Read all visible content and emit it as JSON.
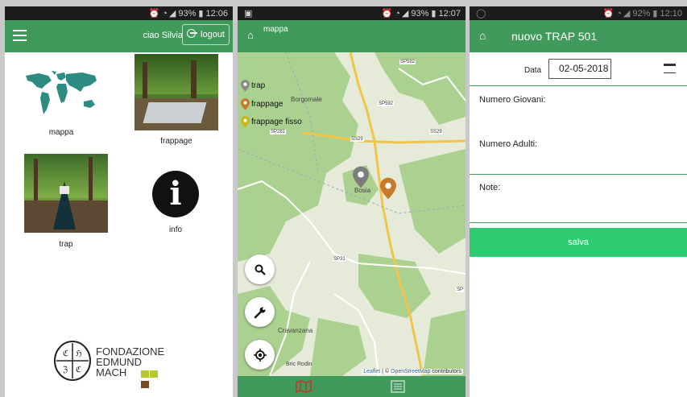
{
  "screen1": {
    "status_time": "12:06",
    "status_battery": "93%",
    "greeting": "ciao Silvia",
    "logout_label": "logout",
    "tiles": [
      {
        "label": "mappa"
      },
      {
        "label": "frappage"
      },
      {
        "label": "trap"
      },
      {
        "label": "info"
      }
    ],
    "logo": {
      "line1": "FONDAZIONE",
      "line2": "EDMUND",
      "line3": "MACH"
    }
  },
  "screen2": {
    "status_time": "12:07",
    "status_battery": "93%",
    "title": "mappa",
    "legend": [
      {
        "label": "trap",
        "color": "#8a8a8a"
      },
      {
        "label": "frappage",
        "color": "#c77a2c"
      },
      {
        "label": "frappage fisso",
        "color": "#c9b51c"
      }
    ],
    "place_labels": [
      "Borgomale",
      "Bosia",
      "Cravanzana",
      "Bric Rodin"
    ],
    "road_labels": [
      "SP592",
      "SP592",
      "SP281",
      "SS29",
      "SS29",
      "SP31",
      "SP"
    ],
    "attribution": {
      "leaflet": "Leaflet",
      "sep": " | © ",
      "osm": "OpenStreetMap",
      "rest": " contributors"
    },
    "markers": [
      {
        "type": "trap",
        "color": "#7d7d7d"
      },
      {
        "type": "frappage",
        "color": "#c77a2c"
      }
    ]
  },
  "screen3": {
    "status_time": "12:10",
    "status_battery": "92%",
    "title": "nuovo TRAP 501",
    "date_label": "Data",
    "date_value": "02-05-2018",
    "fields": [
      "Numero Giovani:",
      "Numero Adulti:",
      "Note:"
    ],
    "save_label": "salva"
  },
  "colors": {
    "primary": "#3f9a5b",
    "save": "#2ecc71",
    "statusbar": "#1c1c1c"
  }
}
